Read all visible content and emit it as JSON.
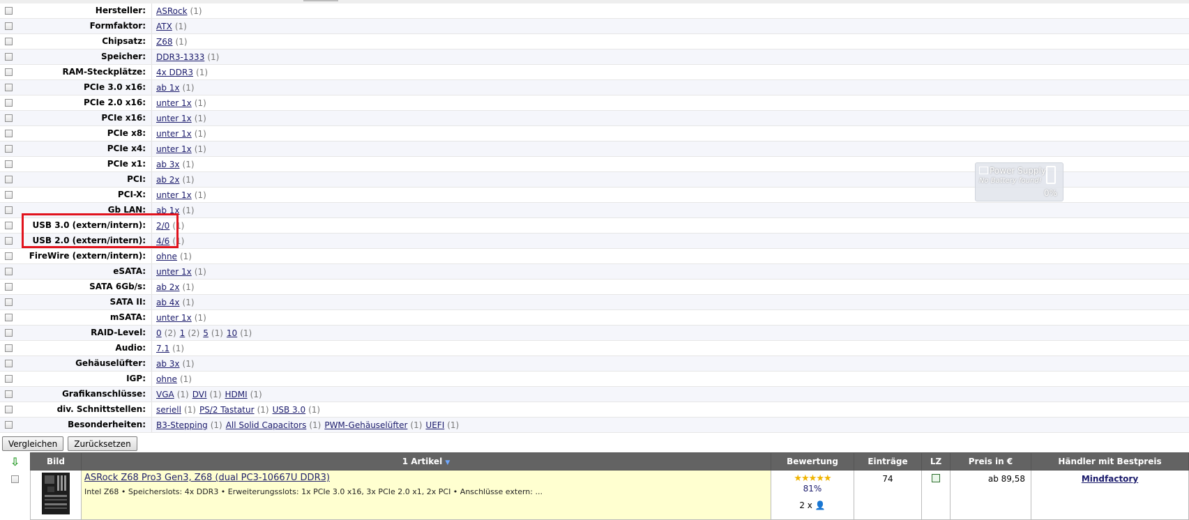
{
  "filters": [
    {
      "label": "Hersteller:",
      "values": [
        {
          "text": "ASRock",
          "count": "(1)"
        }
      ]
    },
    {
      "label": "Formfaktor:",
      "values": [
        {
          "text": "ATX",
          "count": "(1)"
        }
      ]
    },
    {
      "label": "Chipsatz:",
      "values": [
        {
          "text": "Z68",
          "count": "(1)"
        }
      ]
    },
    {
      "label": "Speicher:",
      "values": [
        {
          "text": "DDR3-1333",
          "count": "(1)"
        }
      ]
    },
    {
      "label": "RAM-Steckplätze:",
      "values": [
        {
          "text": "4x DDR3",
          "count": "(1)"
        }
      ]
    },
    {
      "label": "PCIe 3.0 x16:",
      "values": [
        {
          "text": "ab 1x",
          "count": "(1)"
        }
      ]
    },
    {
      "label": "PCIe 2.0 x16:",
      "values": [
        {
          "text": "unter 1x",
          "count": "(1)"
        }
      ]
    },
    {
      "label": "PCIe x16:",
      "values": [
        {
          "text": "unter 1x",
          "count": "(1)"
        }
      ]
    },
    {
      "label": "PCIe x8:",
      "values": [
        {
          "text": "unter 1x",
          "count": "(1)"
        }
      ]
    },
    {
      "label": "PCIe x4:",
      "values": [
        {
          "text": "unter 1x",
          "count": "(1)"
        }
      ]
    },
    {
      "label": "PCIe x1:",
      "values": [
        {
          "text": "ab 3x",
          "count": "(1)"
        }
      ]
    },
    {
      "label": "PCI:",
      "values": [
        {
          "text": "ab 2x",
          "count": "(1)"
        }
      ]
    },
    {
      "label": "PCI-X:",
      "values": [
        {
          "text": "unter 1x",
          "count": "(1)"
        }
      ]
    },
    {
      "label": "Gb LAN:",
      "values": [
        {
          "text": "ab 1x",
          "count": "(1)"
        }
      ]
    },
    {
      "label": "USB 3.0 (extern/intern):",
      "values": [
        {
          "text": "2/0",
          "count": "(1)"
        }
      ]
    },
    {
      "label": "USB 2.0 (extern/intern):",
      "values": [
        {
          "text": "4/6",
          "count": "(1)"
        }
      ]
    },
    {
      "label": "FireWire (extern/intern):",
      "values": [
        {
          "text": "ohne",
          "count": "(1)"
        }
      ]
    },
    {
      "label": "eSATA:",
      "values": [
        {
          "text": "unter 1x",
          "count": "(1)"
        }
      ]
    },
    {
      "label": "SATA 6Gb/s:",
      "values": [
        {
          "text": "ab 2x",
          "count": "(1)"
        }
      ]
    },
    {
      "label": "SATA II:",
      "values": [
        {
          "text": "ab 4x",
          "count": "(1)"
        }
      ]
    },
    {
      "label": "mSATA:",
      "values": [
        {
          "text": "unter 1x",
          "count": "(1)"
        }
      ]
    },
    {
      "label": "RAID-Level:",
      "values": [
        {
          "text": "0",
          "count": "(2)"
        },
        {
          "text": "1",
          "count": "(2)"
        },
        {
          "text": "5",
          "count": "(1)"
        },
        {
          "text": "10",
          "count": "(1)"
        }
      ]
    },
    {
      "label": "Audio:",
      "values": [
        {
          "text": "7.1",
          "count": "(1)"
        }
      ]
    },
    {
      "label": "Gehäuselüfter:",
      "values": [
        {
          "text": "ab 3x",
          "count": "(1)"
        }
      ]
    },
    {
      "label": "IGP:",
      "values": [
        {
          "text": "ohne",
          "count": "(1)"
        }
      ]
    },
    {
      "label": "Grafikanschlüsse:",
      "values": [
        {
          "text": "VGA",
          "count": "(1)"
        },
        {
          "text": "DVI",
          "count": "(1)"
        },
        {
          "text": "HDMI",
          "count": "(1)"
        }
      ]
    },
    {
      "label": "div. Schnittstellen:",
      "values": [
        {
          "text": "seriell",
          "count": "(1)"
        },
        {
          "text": "PS/2 Tastatur",
          "count": "(1)"
        },
        {
          "text": "USB 3.0",
          "count": "(1)"
        }
      ]
    },
    {
      "label": "Besonderheiten:",
      "values": [
        {
          "text": "B3-Stepping",
          "count": "(1)"
        },
        {
          "text": "All Solid Capacitors",
          "count": "(1)"
        },
        {
          "text": "PWM-Gehäuselüfter",
          "count": "(1)"
        },
        {
          "text": "UEFI",
          "count": "(1)"
        }
      ]
    }
  ],
  "buttons": {
    "compare": "Vergleichen",
    "reset": "Zurücksetzen"
  },
  "table": {
    "headers": {
      "image": "Bild",
      "articles": "1 Artikel",
      "rating": "Bewertung",
      "entries": "Einträge",
      "lz": "LZ",
      "price": "Preis in €",
      "dealer": "Händler mit Bestpreis"
    },
    "sort_arrow": "⇩",
    "product": {
      "title": "ASRock Z68 Pro3 Gen3, Z68 (dual PC3-10667U DDR3)",
      "description": "Intel Z68 • Speicherslots: 4x DDR3 • Erweiterungsslots: 1x PCIe 3.0 x16, 3x PCIe 2.0 x1, 2x PCI • Anschlüsse extern: ...",
      "stars": "★★★★★",
      "rating_percent": "81%",
      "rating_count": "2 x",
      "entries": "74",
      "price": "ab 89,58",
      "dealer": "Mindfactory"
    }
  },
  "overlay": {
    "title": "Power Supply",
    "subtitle": "No Battery found!",
    "percent": "0%"
  }
}
